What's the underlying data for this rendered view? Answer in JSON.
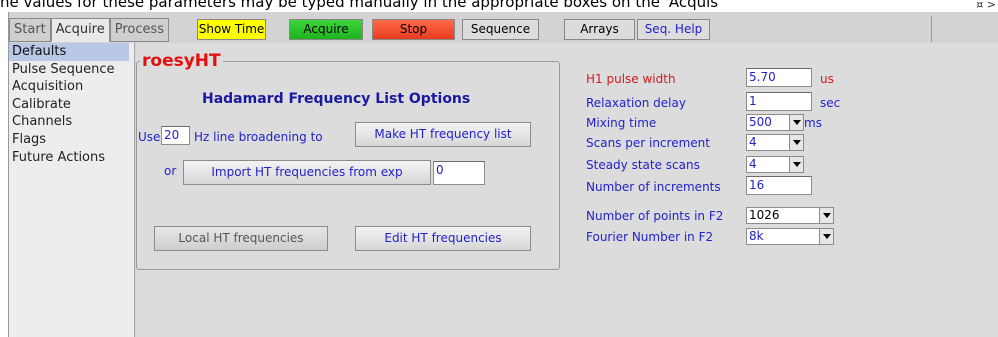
{
  "top_strip": {
    "text": "he values for these parameters may be typed manually in the appropriate boxes on the 'Acquis",
    "window_controls": "¤ >"
  },
  "tabs": [
    "Start",
    "Acquire",
    "Process"
  ],
  "toolbar": {
    "show_time": "Show Time",
    "acquire": "Acquire",
    "stop": "Stop",
    "sequence": "Sequence",
    "arrays": "Arrays",
    "seq_help": "Seq. Help"
  },
  "sidebar": {
    "items": [
      "Defaults",
      "Pulse Sequence",
      "Acquisition",
      "Calibrate",
      "Channels",
      "Flags",
      "Future Actions"
    ]
  },
  "hadamard": {
    "title": "roesyHT",
    "heading": "Hadamard Frequency List Options",
    "use_label": "Use",
    "broadening_value": "20",
    "broadening_suffix": "Hz line broadening to",
    "make_list_button": "Make HT frequency list",
    "or_label": "or",
    "import_button": "Import HT frequencies from exp",
    "import_exp_value": "0",
    "local_button": "Local HT frequencies",
    "edit_button": "Edit HT frequencies"
  },
  "params": {
    "h1_pulse_width": {
      "label": "H1 pulse width",
      "value": "5.70",
      "unit": "us"
    },
    "relaxation_delay": {
      "label": "Relaxation delay",
      "value": "1",
      "unit": "sec"
    },
    "mixing_time": {
      "label": "Mixing time",
      "value": "500",
      "unit": "ms"
    },
    "scans_per_increment": {
      "label": "Scans per increment",
      "value": "4"
    },
    "steady_state_scans": {
      "label": "Steady state scans",
      "value": "4"
    },
    "number_of_increments": {
      "label": "Number of increments",
      "value": "16"
    },
    "points_f2": {
      "label": "Number of points in F2",
      "value": "1026"
    },
    "fourier_f2": {
      "label": "Fourier Number in F2",
      "value": "8k"
    }
  }
}
